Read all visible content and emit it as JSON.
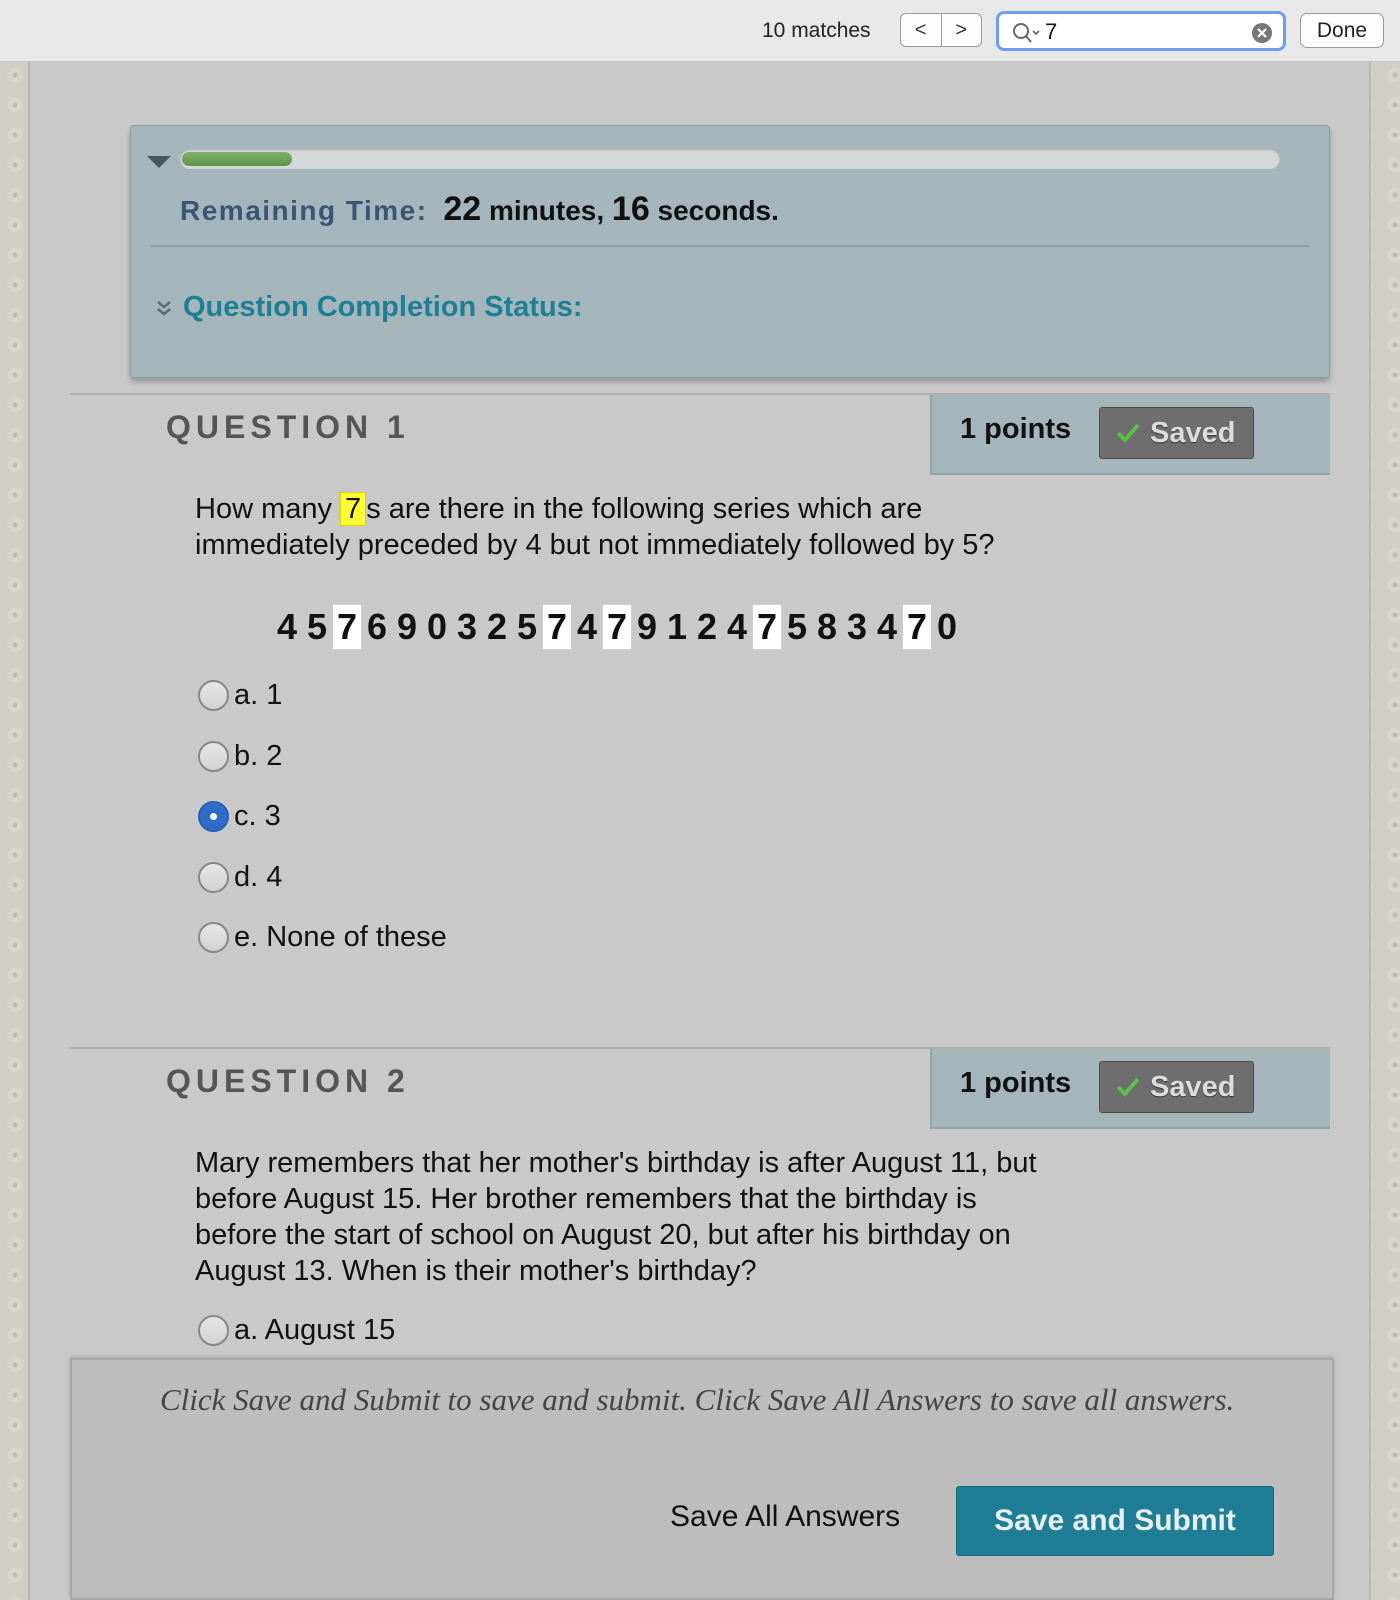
{
  "findbar": {
    "match_count": "10 matches",
    "prev_label": "<",
    "next_label": ">",
    "query": "7",
    "done_label": "Done"
  },
  "timer": {
    "progress": 0.1,
    "label": "Remaining Time:",
    "minutes": "22",
    "minutes_unit": "minutes,",
    "seconds": "16",
    "seconds_unit": "seconds.",
    "completion_status_label": "Question Completion Status:"
  },
  "questions": [
    {
      "title": "QUESTION 1",
      "points": "1 points",
      "saved_label": "Saved",
      "text_before": "How many ",
      "text_highlight": "7",
      "text_after": "s are there in the following series which are immediately preceded by 4 but not immediately followed by 5?",
      "series": [
        "4",
        "5",
        "7",
        "6",
        "9",
        "0",
        "3",
        "2",
        "5",
        "7",
        "4",
        "7",
        "9",
        "1",
        "2",
        "4",
        "7",
        "5",
        "8",
        "3",
        "4",
        "7",
        "0"
      ],
      "options": [
        {
          "letter": "a.",
          "text": "1",
          "checked": false
        },
        {
          "letter": "b.",
          "text": "2",
          "checked": false
        },
        {
          "letter": "c.",
          "text": "3",
          "checked": true
        },
        {
          "letter": "d.",
          "text": "4",
          "checked": false
        },
        {
          "letter": "e.",
          "text": "None of these",
          "checked": false
        }
      ]
    },
    {
      "title": "QUESTION 2",
      "points": "1 points",
      "saved_label": "Saved",
      "text": "Mary remembers that her mother's birthday is after August 11, but before August 15. Her brother remembers that the birthday is before the start of school on August 20, but after his birthday on August 13. When is their mother's birthday?",
      "options": [
        {
          "letter": "a.",
          "text": "August 15",
          "checked": false
        }
      ]
    }
  ],
  "submit": {
    "note": "Click Save and Submit to save and submit. Click Save All Answers to save all answers.",
    "save_all_label": "Save All Answers",
    "save_submit_label": "Save and Submit"
  },
  "colors": {
    "accent": "#1f7e95",
    "panel": "#a4b6bb",
    "highlight": "#ffff33",
    "radio_checked": "#2f6cc8"
  }
}
